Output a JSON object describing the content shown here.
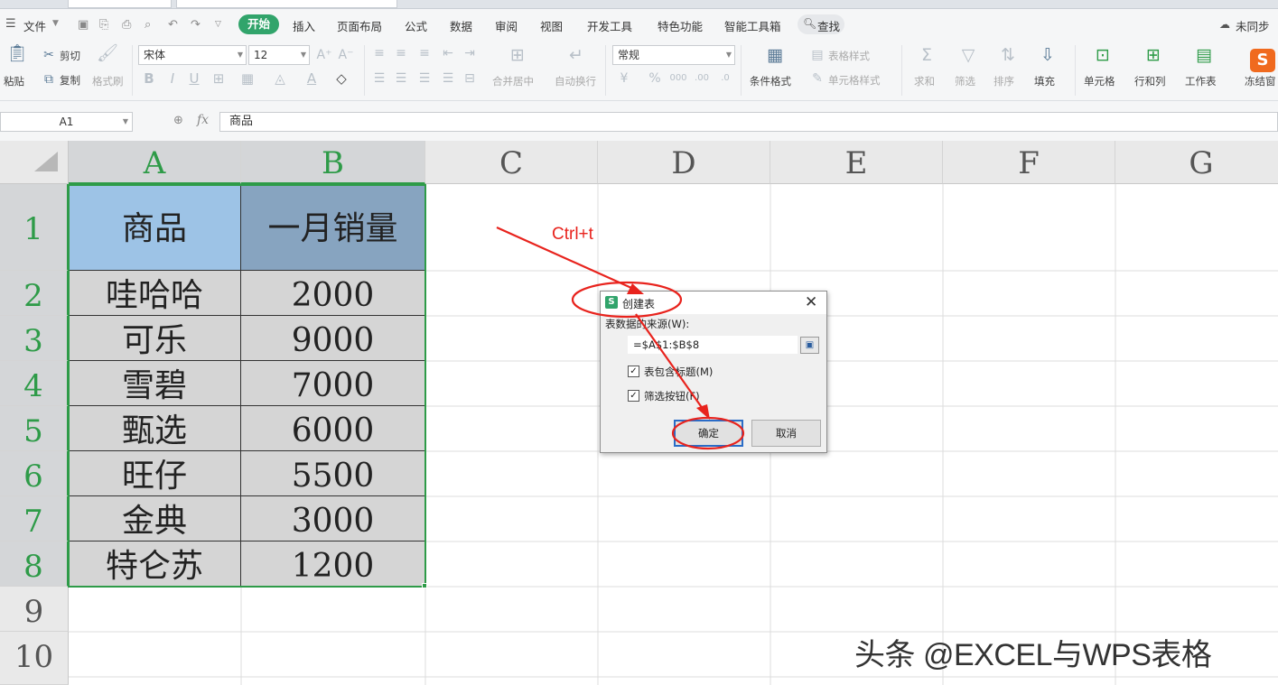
{
  "ribbon_menu": {
    "file": "文件",
    "items": [
      "开始",
      "插入",
      "页面布局",
      "公式",
      "数据",
      "审阅",
      "视图",
      "开发工具",
      "特色功能",
      "智能工具箱"
    ],
    "search": "查找",
    "sync": "未同步"
  },
  "ribbon": {
    "paste": "粘贴",
    "cut": "剪切",
    "copy": "复制",
    "format_painter": "格式刷",
    "font_name": "宋体",
    "font_size": "12",
    "merge_center": "合并居中",
    "wrap_text": "自动换行",
    "number_format": "常规",
    "conditional_format": "条件格式",
    "table_style": "表格样式",
    "cell_style": "单元格样式",
    "sum": "求和",
    "filter": "筛选",
    "sort": "排序",
    "fill": "填充",
    "cell": "单元格",
    "row_col": "行和列",
    "worksheet": "工作表",
    "freeze": "冻结窗"
  },
  "formula_bar": {
    "name_box": "A1",
    "fx": "fx",
    "content": "商品"
  },
  "sheet": {
    "columns": [
      "A",
      "B",
      "C",
      "D",
      "E",
      "F",
      "G"
    ],
    "rows": [
      "1",
      "2",
      "3",
      "4",
      "5",
      "6",
      "7",
      "8",
      "9",
      "10"
    ],
    "header": [
      "商品",
      "一月销量"
    ],
    "data": [
      [
        "哇哈哈",
        "2000"
      ],
      [
        "可乐",
        "9000"
      ],
      [
        "雪碧",
        "7000"
      ],
      [
        "甄选",
        "6000"
      ],
      [
        "旺仔",
        "5500"
      ],
      [
        "金典",
        "3000"
      ],
      [
        "特仑苏",
        "1200"
      ]
    ]
  },
  "dialog": {
    "title": "创建表",
    "source_label": "表数据的来源(W):",
    "range": "=$A$1:$B$8",
    "has_header_label": "表包含标题(M)",
    "has_header_checked": true,
    "filter_button_label": "筛选按钮(F)",
    "filter_button_checked": true,
    "ok": "确定",
    "cancel": "取消"
  },
  "annotation": {
    "text": "Ctrl+t",
    "color": "#e8231d"
  },
  "watermark": "头条 @EXCEL与WPS表格"
}
